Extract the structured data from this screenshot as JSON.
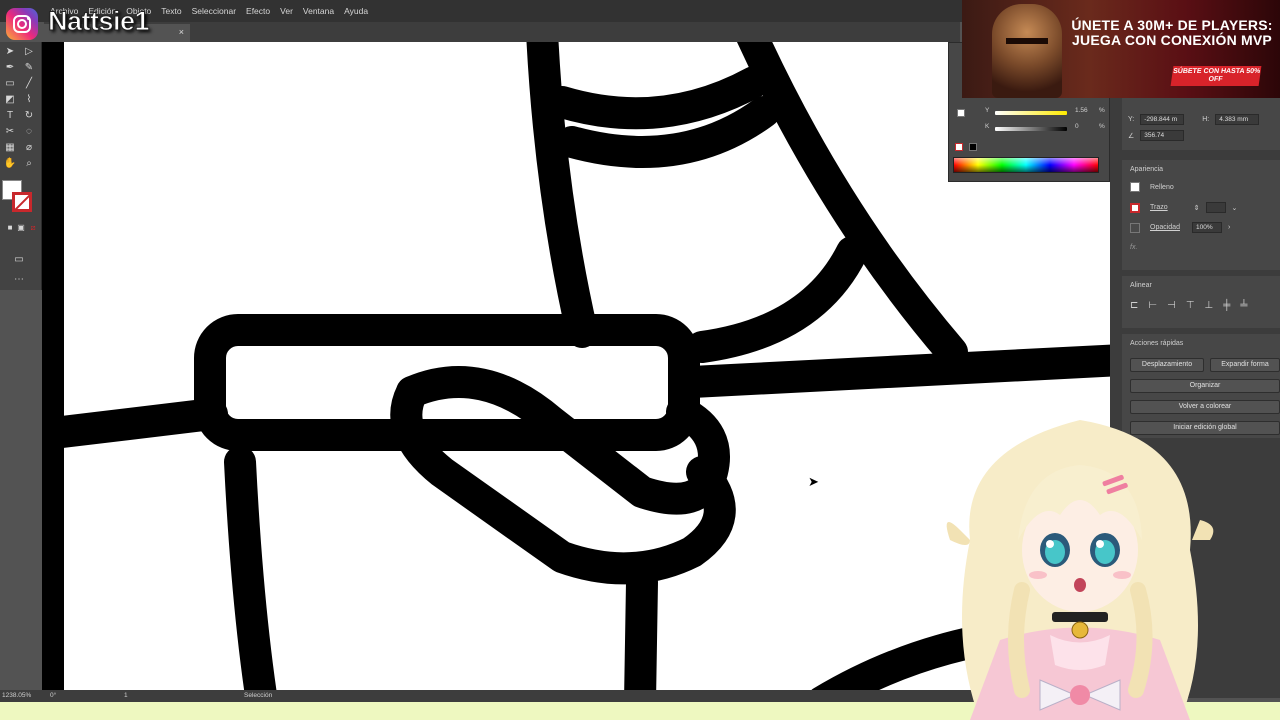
{
  "menubar": {
    "items": [
      "Archivo",
      "Edición",
      "Objeto",
      "Texto",
      "Seleccionar",
      "Efecto",
      "Ver",
      "Ventana",
      "Ayuda"
    ]
  },
  "overlay": {
    "instagram_handle": "Nattsie1"
  },
  "document_tab": {
    "close": "×"
  },
  "ad": {
    "headline": "ÚNETE A 30M+ DE PLAYERS: JUEGA CON CONEXIÓN MVP",
    "cta": "SÚBETE CON HASTA 50% OFF"
  },
  "transform_panel": {
    "y_value": "-298.844 m",
    "h_value": "4.383 mm",
    "angle_value": "356.74"
  },
  "color_panel": {
    "y_label": "Y",
    "k_label": "K",
    "y_value": "1.56",
    "k_value": "0",
    "percent": "%"
  },
  "appearance": {
    "header": "Apariencia",
    "fill_label": "Relleno",
    "stroke_label": "Trazo",
    "opacity_label": "Opacidad",
    "opacity_value": "100%",
    "fx_label": "fx."
  },
  "align": {
    "header": "Alinear"
  },
  "quick_actions": {
    "header": "Acciones rápidas",
    "offset_path": "Desplazamiento",
    "expand_shape": "Expandir forma",
    "arrange": "Organizar",
    "recolor": "Volver a colorear",
    "global_edit": "Iniciar edición global"
  },
  "statusbar": {
    "zoom": "1238.05%",
    "rotation": "0°",
    "artboard": "1",
    "tool": "Selección"
  },
  "colors": {
    "menubar_bg": "#323232",
    "panel_bg": "#474747",
    "stroke_red": "#c8282c",
    "ad_cta": "#d8232a",
    "bottom_strip": "#eef8c0"
  }
}
